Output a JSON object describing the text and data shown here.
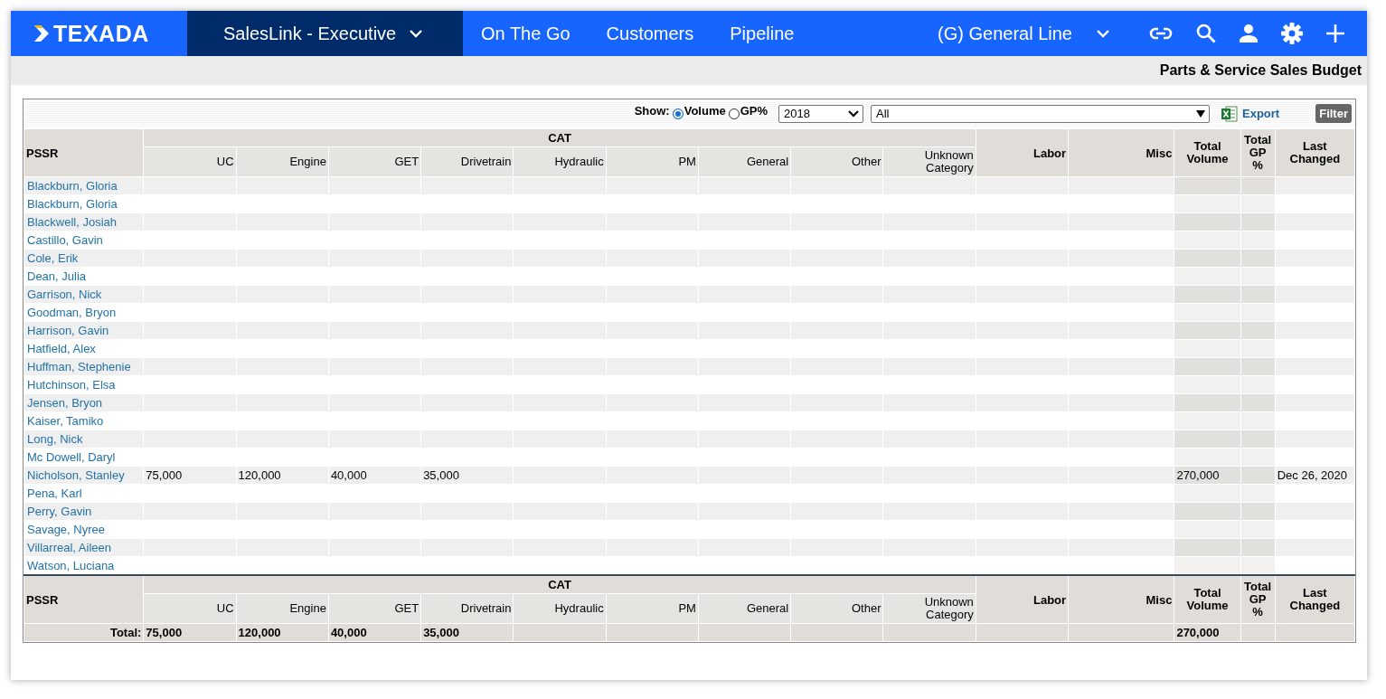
{
  "nav": {
    "logo": "TEXADA",
    "app": "SalesLink - Executive",
    "links": [
      "On The Go",
      "Customers",
      "Pipeline"
    ],
    "line": "(G) General Line"
  },
  "page_title": "Parts & Service Sales Budget",
  "toolbar": {
    "show_label": "Show:",
    "options": [
      {
        "label": "Volume",
        "selected": true
      },
      {
        "label": "GP%",
        "selected": false
      }
    ],
    "year": "2018",
    "category": "All",
    "export": "Export",
    "filter_button": "Filter"
  },
  "table": {
    "header": {
      "first_column": "PSSR",
      "group": "CAT",
      "group_columns": [
        "UC",
        "Engine",
        "GET",
        "Drivetrain",
        "Hydraulic",
        "PM",
        "General",
        "Other",
        "Unknown Category"
      ],
      "other_columns": [
        {
          "label": "Labor",
          "kind": "plain"
        },
        {
          "label": "Misc",
          "kind": "plain"
        },
        {
          "label": "Total Volume",
          "kind": "total"
        },
        {
          "label": "Total GP %",
          "kind": "total"
        },
        {
          "label": "Last Changed",
          "kind": "date"
        }
      ]
    },
    "rows": [
      {
        "name": "Blackburn, Gloria"
      },
      {
        "name": "Blackburn, Gloria"
      },
      {
        "name": "Blackwell, Josiah"
      },
      {
        "name": "Castillo, Gavin"
      },
      {
        "name": "Cole, Erik"
      },
      {
        "name": "Dean, Julia"
      },
      {
        "name": "Garrison, Nick"
      },
      {
        "name": "Goodman, Bryon"
      },
      {
        "name": "Harrison, Gavin"
      },
      {
        "name": "Hatfield, Alex"
      },
      {
        "name": "Huffman, Stephenie"
      },
      {
        "name": "Hutchinson, Elsa"
      },
      {
        "name": "Jensen, Bryon"
      },
      {
        "name": "Kaiser, Tamiko"
      },
      {
        "name": "Long, Nick"
      },
      {
        "name": "Mc Dowell, Daryl"
      },
      {
        "name": "Nicholson, Stanley",
        "values": [
          "75,000",
          "120,000",
          "40,000",
          "35,000"
        ],
        "total_volume": "270,000",
        "last_changed": "Dec 26, 2020"
      },
      {
        "name": "Pena, Karl"
      },
      {
        "name": "Perry, Gavin"
      },
      {
        "name": "Savage, Nyree"
      },
      {
        "name": "Villarreal, Aileen"
      },
      {
        "name": "Watson, Luciana"
      }
    ],
    "footer_header": {
      "first_column": "PSSR",
      "group": "CAT",
      "group_columns": [
        "UC",
        "Engine",
        "GET",
        "Drivetrain",
        "Hydraulic",
        "PM",
        "General",
        "Other",
        "Unknown Category"
      ],
      "other_columns": [
        {
          "label": "Labor",
          "kind": "plain"
        },
        {
          "label": "Misc",
          "kind": "plain"
        },
        {
          "label": "Total Volume",
          "kind": "total"
        },
        {
          "label": "Total GP %",
          "kind": "total"
        },
        {
          "label": "Last Changed",
          "kind": "date"
        }
      ]
    },
    "totals": {
      "label": "Total:",
      "values": [
        "75,000",
        "120,000",
        "40,000",
        "35,000"
      ],
      "total_volume": "270,000"
    }
  }
}
